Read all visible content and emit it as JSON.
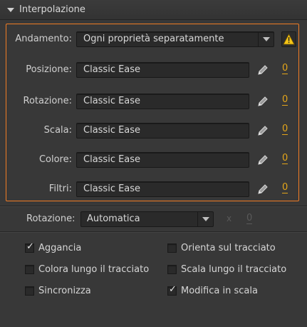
{
  "header": {
    "title": "Interpolazione"
  },
  "andamento": {
    "label": "Andamento:",
    "value": "Ogni proprietà separatamente"
  },
  "properties": [
    {
      "label": "Posizione:",
      "value": "Classic Ease",
      "count": "0"
    },
    {
      "label": "Rotazione:",
      "value": "Classic Ease",
      "count": "0"
    },
    {
      "label": "Scala:",
      "value": "Classic Ease",
      "count": "0"
    },
    {
      "label": "Colore:",
      "value": "Classic Ease",
      "count": "0"
    },
    {
      "label": "Filtri:",
      "value": "Classic Ease",
      "count": "0"
    }
  ],
  "rotation": {
    "label": "Rotazione:",
    "value": "Automatica",
    "times_symbol": "x",
    "count": "0"
  },
  "options": [
    {
      "label": "Aggancia",
      "checked": true
    },
    {
      "label": "Orienta sul tracciato",
      "checked": false
    },
    {
      "label": "Colora lungo il tracciato",
      "checked": false
    },
    {
      "label": "Scala lungo il tracciato",
      "checked": false
    },
    {
      "label": "Sincronizza",
      "checked": false
    },
    {
      "label": "Modifica in scala",
      "checked": true
    }
  ],
  "colors": {
    "accent_orange": "#f07c24",
    "link_gold": "#e3a51a",
    "warning_yellow": "#f5c518"
  },
  "check_glyph": "✓"
}
